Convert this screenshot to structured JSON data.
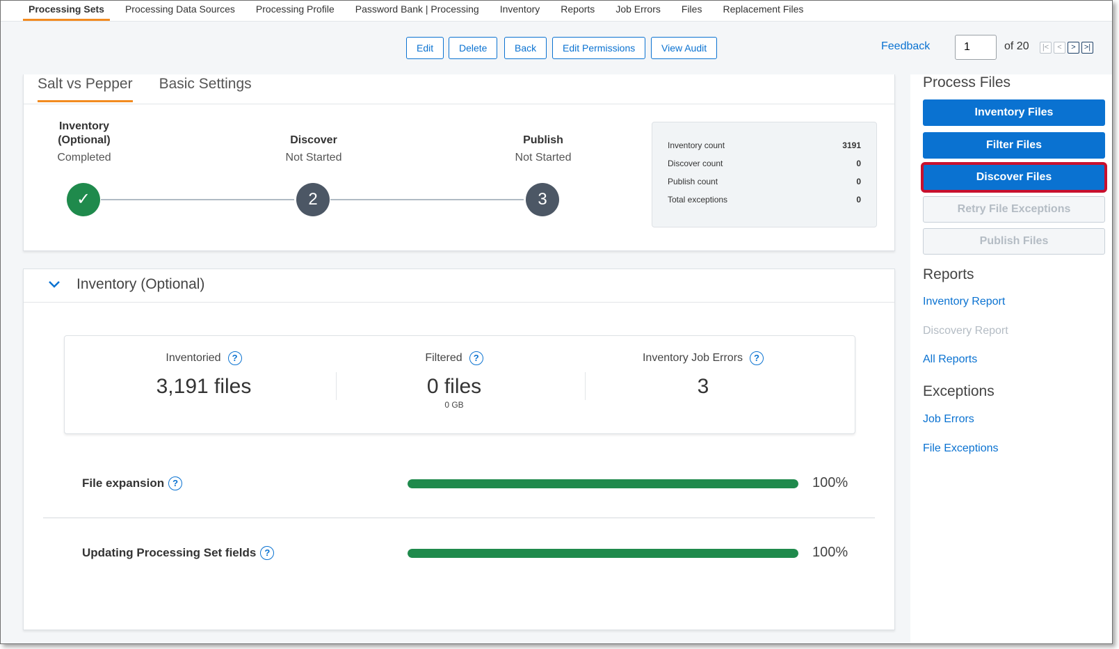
{
  "nav": {
    "tabs": [
      {
        "label": "Processing Sets",
        "active": true
      },
      {
        "label": "Processing Data Sources",
        "active": false
      },
      {
        "label": "Processing Profile",
        "active": false
      },
      {
        "label": "Password Bank | Processing",
        "active": false
      },
      {
        "label": "Inventory",
        "active": false
      },
      {
        "label": "Reports",
        "active": false
      },
      {
        "label": "Job Errors",
        "active": false
      },
      {
        "label": "Files",
        "active": false
      },
      {
        "label": "Replacement Files",
        "active": false
      }
    ]
  },
  "toolbar": {
    "edit": "Edit",
    "delete": "Delete",
    "back": "Back",
    "edit_permissions": "Edit Permissions",
    "view_audit": "View Audit",
    "feedback": "Feedback",
    "page_value": "1",
    "of_pages": "of 20"
  },
  "set": {
    "tabs": [
      "Salt vs Pepper",
      "Basic Settings"
    ],
    "steps": [
      {
        "name": "Inventory\n(Optional)",
        "name_line1": "Inventory",
        "name_line2": "(Optional)",
        "state": "Completed",
        "marker": "✓",
        "status": "complete"
      },
      {
        "name": "Discover",
        "state": "Not Started",
        "marker": "2",
        "status": "pending"
      },
      {
        "name": "Publish",
        "state": "Not Started",
        "marker": "3",
        "status": "pending"
      }
    ],
    "counts": [
      {
        "label": "Inventory count",
        "value": "3191"
      },
      {
        "label": "Discover count",
        "value": "0"
      },
      {
        "label": "Publish count",
        "value": "0"
      },
      {
        "label": "Total exceptions",
        "value": "0"
      }
    ]
  },
  "inventory": {
    "title": "Inventory (Optional)",
    "stats": [
      {
        "label": "Inventoried",
        "value": "3,191 files",
        "sub": ""
      },
      {
        "label": "Filtered",
        "value": "0 files",
        "sub": "0 GB"
      },
      {
        "label": "Inventory Job Errors",
        "value": "3",
        "sub": ""
      }
    ],
    "progress": [
      {
        "label": "File expansion",
        "percent": 100,
        "percent_label": "100%"
      },
      {
        "label": "Updating Processing Set fields",
        "percent": 100,
        "percent_label": "100%"
      }
    ]
  },
  "sidebar": {
    "process_title": "Process Files",
    "buttons": [
      {
        "label": "Inventory Files",
        "state": "enabled"
      },
      {
        "label": "Filter Files",
        "state": "enabled"
      },
      {
        "label": "Discover Files",
        "state": "highlighted"
      },
      {
        "label": "Retry File Exceptions",
        "state": "disabled"
      },
      {
        "label": "Publish Files",
        "state": "disabled"
      }
    ],
    "reports_title": "Reports",
    "reports": [
      {
        "label": "Inventory Report",
        "enabled": true
      },
      {
        "label": "Discovery Report",
        "enabled": false
      },
      {
        "label": "All Reports",
        "enabled": true
      }
    ],
    "exceptions_title": "Exceptions",
    "exceptions": [
      {
        "label": "Job Errors",
        "enabled": true
      },
      {
        "label": "File Exceptions",
        "enabled": true
      }
    ]
  },
  "colors": {
    "accent": "#0a72d1",
    "tab_underline": "#f28b20",
    "success": "#1f8a4c",
    "pending": "#4c5765",
    "highlight_border": "#c8102e"
  }
}
